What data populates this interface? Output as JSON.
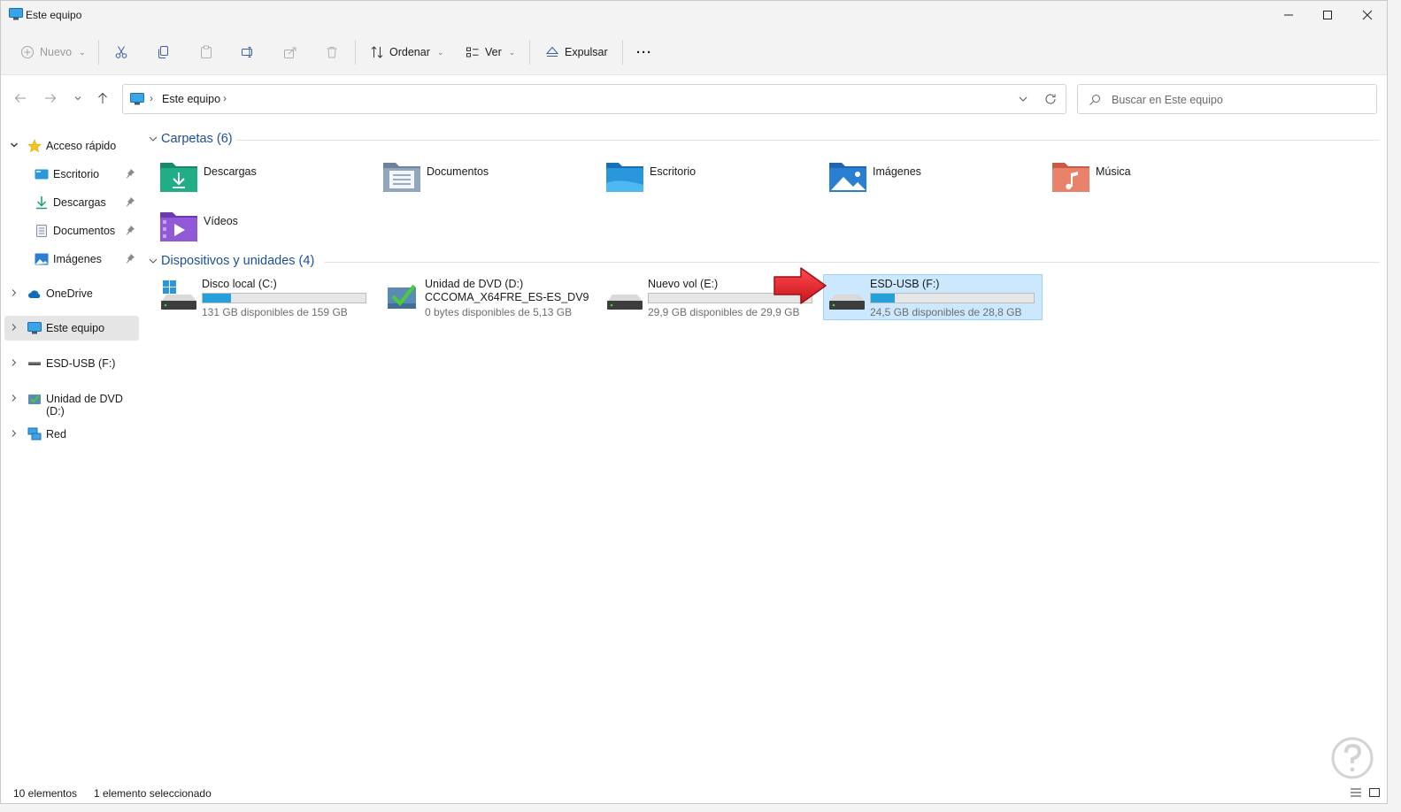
{
  "window": {
    "title": "Este equipo",
    "controls": [
      "minimize",
      "maximize",
      "close"
    ]
  },
  "toolbar": {
    "new_label": "Nuevo",
    "sort_label": "Ordenar",
    "view_label": "Ver",
    "eject_label": "Expulsar",
    "more_label": "···",
    "icons": [
      "new-icon",
      "cut-icon",
      "copy-icon",
      "paste-icon",
      "rename-icon",
      "share-icon",
      "delete-icon",
      "sort-icon",
      "view-icon",
      "eject-icon",
      "more-icon"
    ]
  },
  "address": {
    "crumbs": [
      "Este equipo"
    ],
    "search_placeholder": "Buscar en Este equipo"
  },
  "sidebar": {
    "quick_access": "Acceso rápido",
    "pinned": [
      {
        "label": "Escritorio"
      },
      {
        "label": "Descargas"
      },
      {
        "label": "Documentos"
      },
      {
        "label": "Imágenes"
      }
    ],
    "onedrive": "OneDrive",
    "this_pc": "Este equipo",
    "usb": "ESD-USB (F:)",
    "dvd": "Unidad de DVD (D:)",
    "network": "Red"
  },
  "folders_group": {
    "title": "Carpetas (6)",
    "items": [
      {
        "name": "Descargas",
        "color": "#1a9e7a"
      },
      {
        "name": "Documentos",
        "color": "#7f93ad"
      },
      {
        "name": "Escritorio",
        "color": "#1e88d6"
      },
      {
        "name": "Imágenes",
        "color": "#2b7fd3"
      },
      {
        "name": "Música",
        "color": "#e0735a"
      },
      {
        "name": "Vídeos",
        "color": "#8a4fd0"
      }
    ]
  },
  "drives_group": {
    "title": "Dispositivos y unidades (4)",
    "items": [
      {
        "name": "Disco local (C:)",
        "free": "131 GB disponibles de 159 GB",
        "used_fraction": 0.176,
        "has_bar": true,
        "selected": false
      },
      {
        "name": "Unidad de DVD (D:)",
        "subtitle": "CCCOMA_X64FRE_ES-ES_DV9",
        "free": "0 bytes disponibles de 5,13 GB",
        "has_bar": false,
        "selected": false
      },
      {
        "name": "Nuevo vol (E:)",
        "free": "29,9 GB disponibles de 29,9 GB",
        "used_fraction": 0.0,
        "has_bar": true,
        "selected": false
      },
      {
        "name": "ESD-USB (F:)",
        "free": "24,5 GB disponibles de 28,8 GB",
        "used_fraction": 0.149,
        "has_bar": true,
        "selected": true
      }
    ]
  },
  "status": {
    "count": "10 elementos",
    "selection": "1 elemento seleccionado"
  },
  "colors": {
    "accent": "#26a0da",
    "selection_bg": "#cce8ff",
    "group_header": "#1b4f9c",
    "arrow": "#e3262b"
  }
}
